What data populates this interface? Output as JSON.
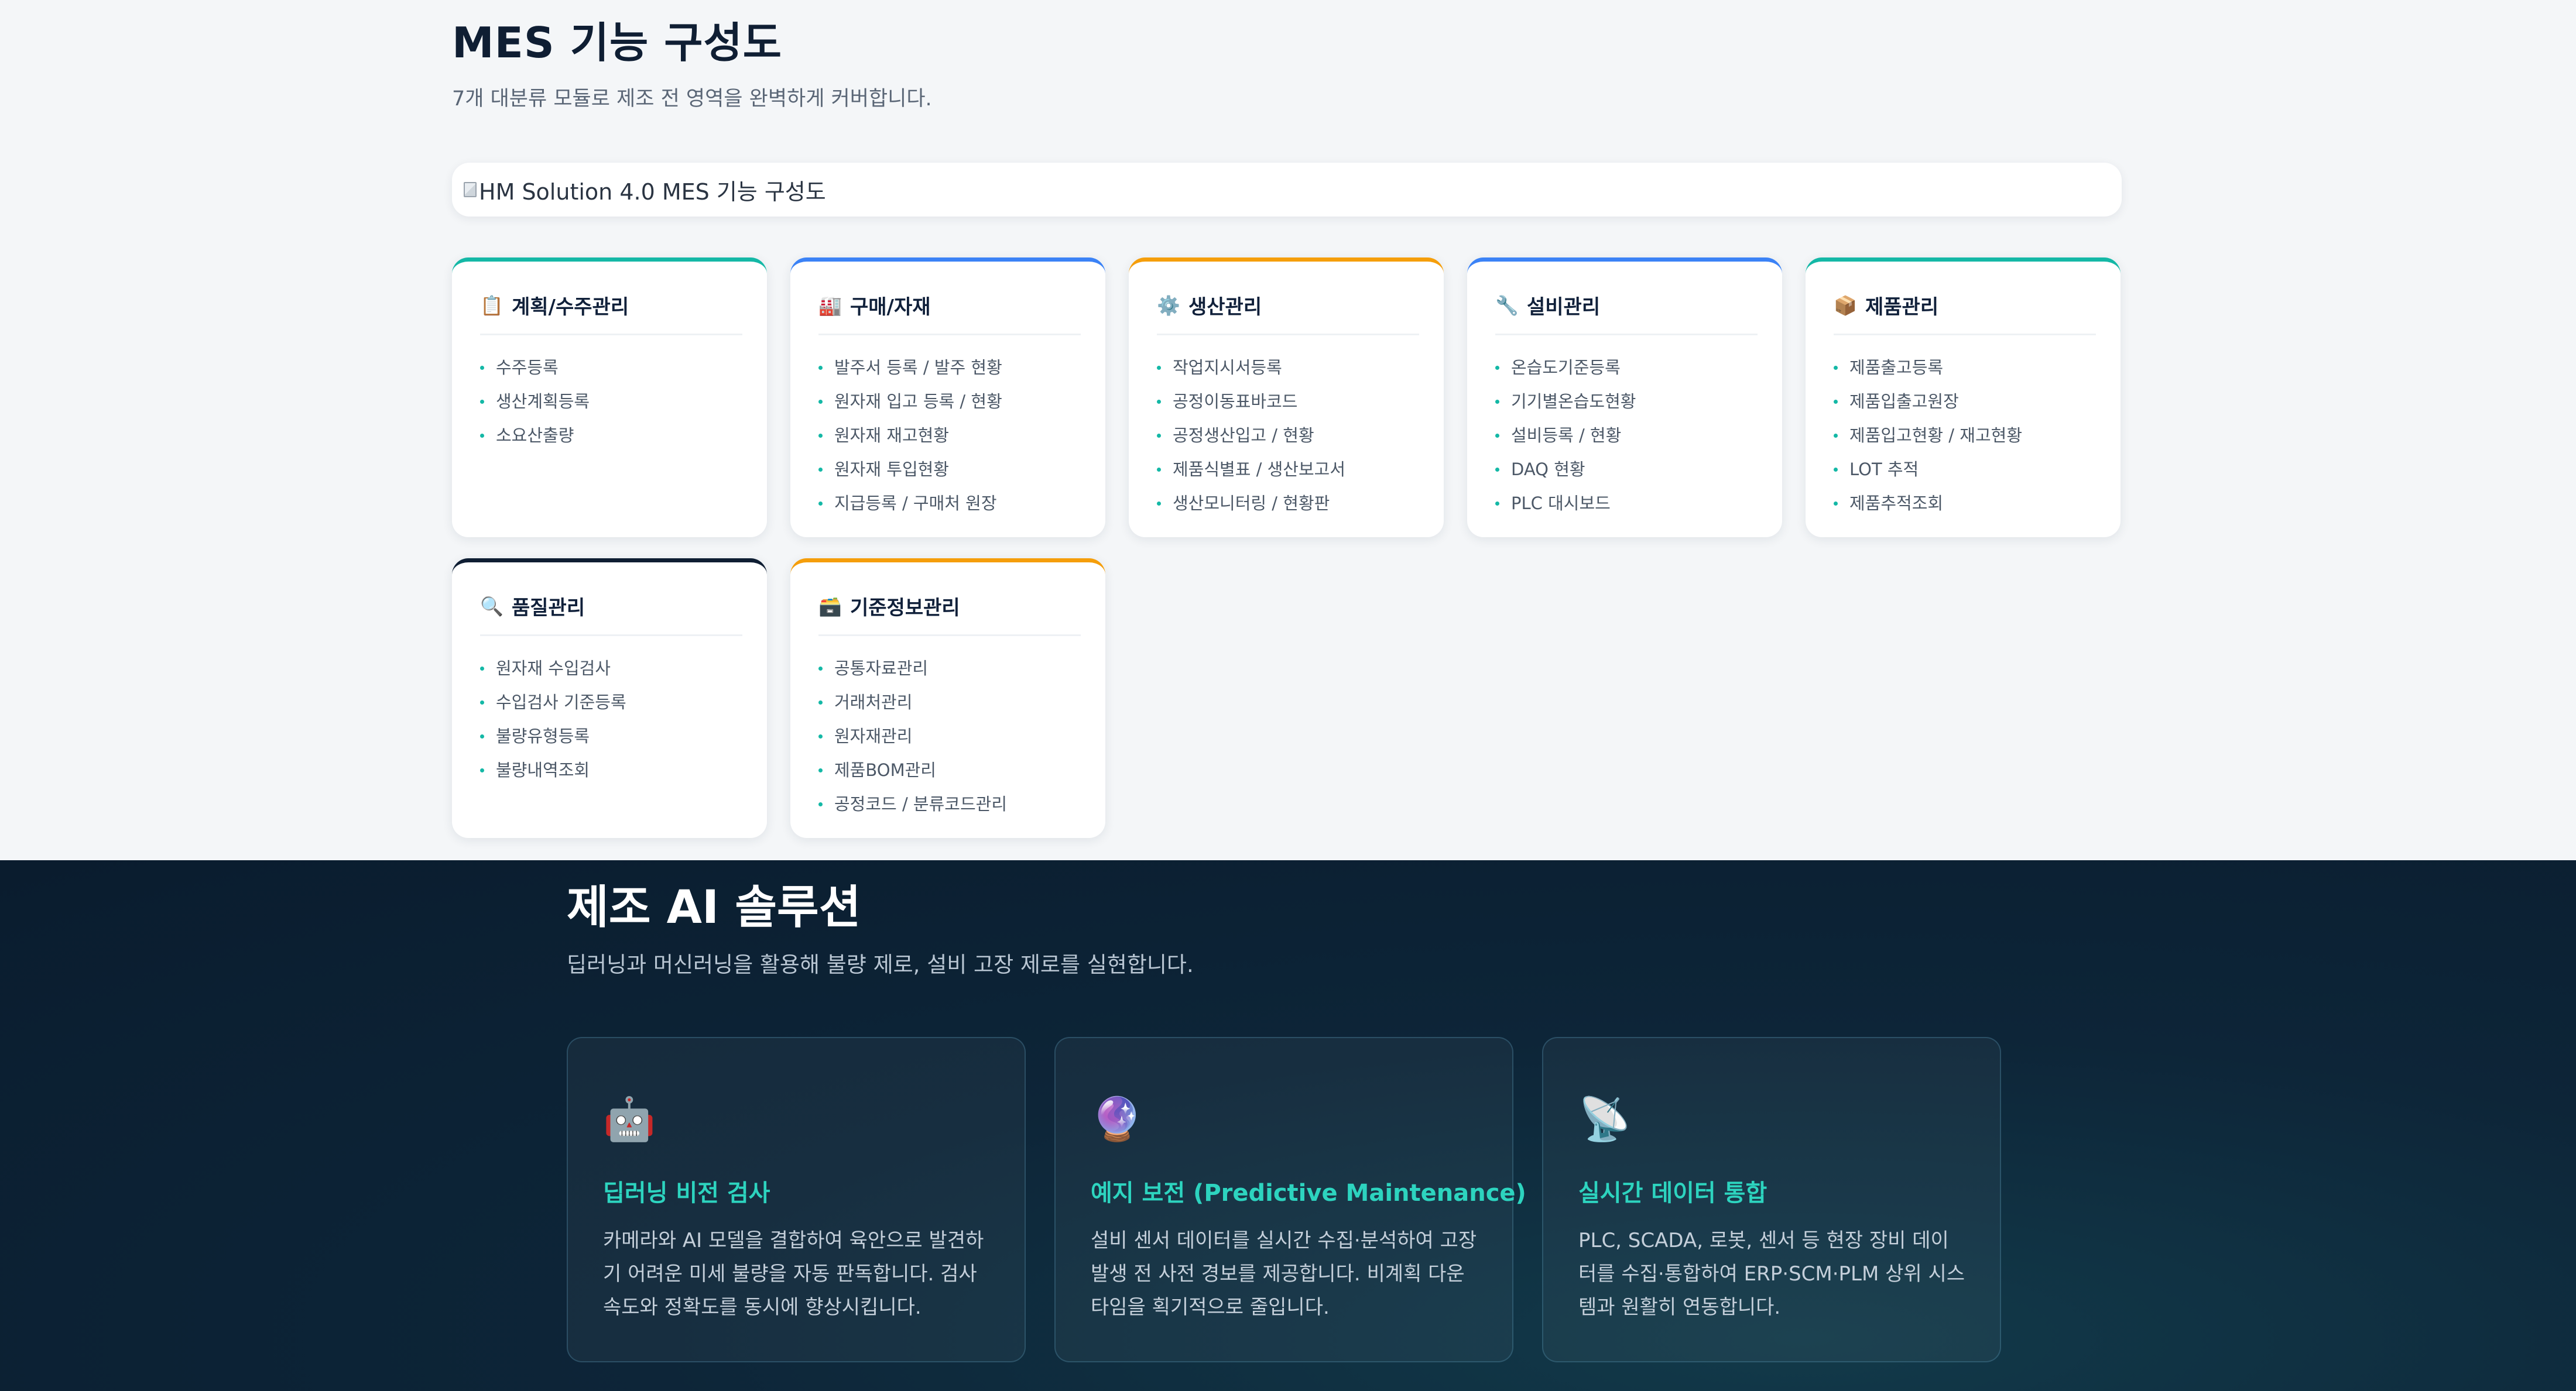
{
  "mes": {
    "title": "MES 기능 구성도",
    "subtitle": "7개 대분류 모듈로 제조 전 영역을 완벽하게 커버합니다.",
    "image_alt": "HM Solution 4.0 MES 기능 구성도",
    "modules": [
      {
        "icon": "📋",
        "icon_name": "clipboard-icon",
        "title": "계획/수주관리",
        "accent": "#14b8a6",
        "items": [
          "수주등록",
          "생산계획등록",
          "소요산출량"
        ]
      },
      {
        "icon": "🏭",
        "icon_name": "factory-icon",
        "title": "구매/자재",
        "accent": "#3b82f6",
        "items": [
          "발주서 등록 / 발주 현황",
          "원자재 입고 등록 / 현황",
          "원자재 재고현황",
          "원자재 투입현황",
          "지급등록 / 구매처 원장"
        ]
      },
      {
        "icon": "⚙️",
        "icon_name": "gear-icon",
        "title": "생산관리",
        "accent": "#f59e0b",
        "items": [
          "작업지시서등록",
          "공정이동표바코드",
          "공정생산입고 / 현황",
          "제품식별표 / 생산보고서",
          "생산모니터링 / 현황판"
        ]
      },
      {
        "icon": "🔧",
        "icon_name": "wrench-icon",
        "title": "설비관리",
        "accent": "#3b82f6",
        "items": [
          "온습도기준등록",
          "기기별온습도현황",
          "설비등록 / 현황",
          "DAQ 현황",
          "PLC 대시보드"
        ]
      },
      {
        "icon": "📦",
        "icon_name": "package-icon",
        "title": "제품관리",
        "accent": "#14b8a6",
        "items": [
          "제품출고등록",
          "제품입출고원장",
          "제품입고현황 / 재고현황",
          "LOT 추적",
          "제품추적조회"
        ]
      },
      {
        "icon": "🔍",
        "icon_name": "magnifier-icon",
        "title": "품질관리",
        "accent": "#0f1e33",
        "items": [
          "원자재 수입검사",
          "수입검사 기준등록",
          "불량유형등록",
          "불량내역조회"
        ]
      },
      {
        "icon": "🗃️",
        "icon_name": "card-file-box-icon",
        "title": "기준정보관리",
        "accent": "#f59e0b",
        "items": [
          "공통자료관리",
          "거래처관리",
          "원자재관리",
          "제품BOM관리",
          "공정코드 / 분류코드관리"
        ]
      }
    ]
  },
  "ai": {
    "title": "제조 AI 솔루션",
    "subtitle": "딥러닝과 머신러닝을 활용해 불량 제로, 설비 고장 제로를 실현합니다.",
    "cards": [
      {
        "icon": "🤖",
        "icon_name": "robot-icon",
        "title": "딥러닝 비전 검사",
        "desc": "카메라와 AI 모델을 결합하여 육안으로 발견하기 어려운 미세 불량을 자동 판독합니다. 검사 속도와 정확도를 동시에 향상시킵니다."
      },
      {
        "icon": "🔮",
        "icon_name": "crystal-ball-icon",
        "title": "예지 보전 (Predictive Maintenance)",
        "desc": "설비 센서 데이터를 실시간 수집·분석하여 고장 발생 전 사전 경보를 제공합니다. 비계획 다운타임을 획기적으로 줄입니다."
      },
      {
        "icon": "📡",
        "icon_name": "satellite-antenna-icon",
        "title": "실시간 데이터 통합",
        "desc": "PLC, SCADA, 로봇, 센서 등 현장 장비 데이터를 수집·통합하여 ERP·SCM·PLM 상위 시스템과 원활히 연동합니다."
      }
    ]
  }
}
